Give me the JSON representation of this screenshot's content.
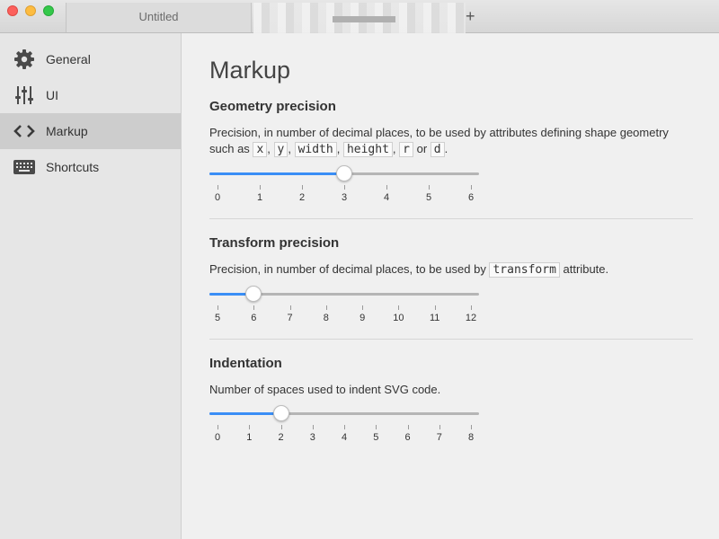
{
  "window": {
    "tab_title": "Untitled",
    "new_tab_label": "+"
  },
  "sidebar": {
    "items": [
      {
        "label": "General",
        "icon": "gear-icon",
        "selected": false
      },
      {
        "label": "UI",
        "icon": "sliders-icon",
        "selected": false
      },
      {
        "label": "Markup",
        "icon": "code-brackets-icon",
        "selected": true
      },
      {
        "label": "Shortcuts",
        "icon": "keyboard-icon",
        "selected": false
      }
    ]
  },
  "main": {
    "title": "Markup",
    "geometry": {
      "title": "Geometry precision",
      "desc_prefix": "Precision, in number of decimal places, to be used by attributes defining shape geometry such as",
      "attrs": [
        "x",
        "y",
        "width",
        "height",
        "r",
        "d"
      ],
      "desc_or": "or",
      "slider": {
        "min": 0,
        "max": 6,
        "value": 3,
        "labels": [
          "0",
          "1",
          "2",
          "3",
          "4",
          "5",
          "6"
        ]
      }
    },
    "transform": {
      "title": "Transform precision",
      "desc_prefix": "Precision, in number of decimal places, to be used by",
      "attr": "transform",
      "desc_suffix": "attribute.",
      "slider": {
        "min": 5,
        "max": 12,
        "value": 6,
        "labels": [
          "5",
          "6",
          "7",
          "8",
          "9",
          "10",
          "11",
          "12"
        ]
      }
    },
    "indentation": {
      "title": "Indentation",
      "desc": "Number of spaces used to indent SVG code.",
      "slider": {
        "min": 0,
        "max": 8,
        "value": 2,
        "labels": [
          "0",
          "1",
          "2",
          "3",
          "4",
          "5",
          "6",
          "7",
          "8"
        ]
      }
    }
  },
  "colors": {
    "accent": "#3a8ef6",
    "sidebar_selected": "#cdcdcd"
  }
}
